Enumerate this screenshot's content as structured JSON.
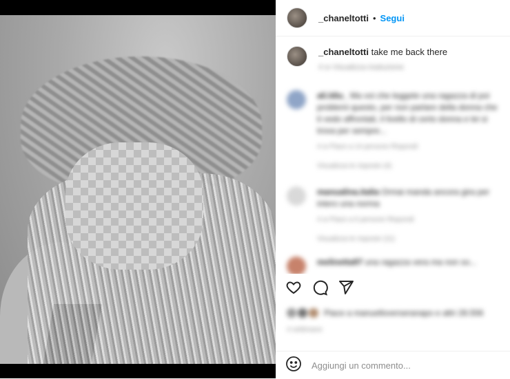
{
  "post": {
    "username": "_chaneltotti",
    "separator": "•",
    "follow_label": "Segui",
    "image_description": "Black and white photo of a person wearing a patterned bucket hat with long hair, face pixelated"
  },
  "caption": {
    "username": "_chaneltotti",
    "text": "take me back there",
    "meta": "4 w  Visualizza traduzione"
  },
  "comments": [
    {
      "username": "ali.ldiu_",
      "text": "Ma voi che leggete una ragazza di poi problemi questo, per non parlare della donna che ti vedo affrontati, il livello di certo donna e lei si trova per sempre...",
      "meta": "4 w  Piace a 14 persone  Rispondi",
      "replies": "Visualizza le risposte (4)",
      "avatar_color": "#8fa5c7"
    },
    {
      "username": "manualina.italia",
      "text": "Ormai manda ancora gira per intero una norma",
      "meta": "4 w  Piace a 6 persone  Rispondi",
      "replies": "Visualizza le risposte (11)",
      "avatar_color": "#d9d9d9"
    },
    {
      "username": "melinetta97",
      "text": "una ragazza vera ma non so...",
      "meta": "",
      "replies": "",
      "avatar_color": "#c7826b"
    }
  ],
  "actions": {
    "like_icon": "heart-icon",
    "comment_icon": "comment-icon",
    "share_icon": "send-icon"
  },
  "likes": {
    "text": "Piace a manuelloverseranapo e altri 28.556"
  },
  "date": "4 settimane",
  "add_comment": {
    "placeholder": "Aggiungi un commento..."
  }
}
